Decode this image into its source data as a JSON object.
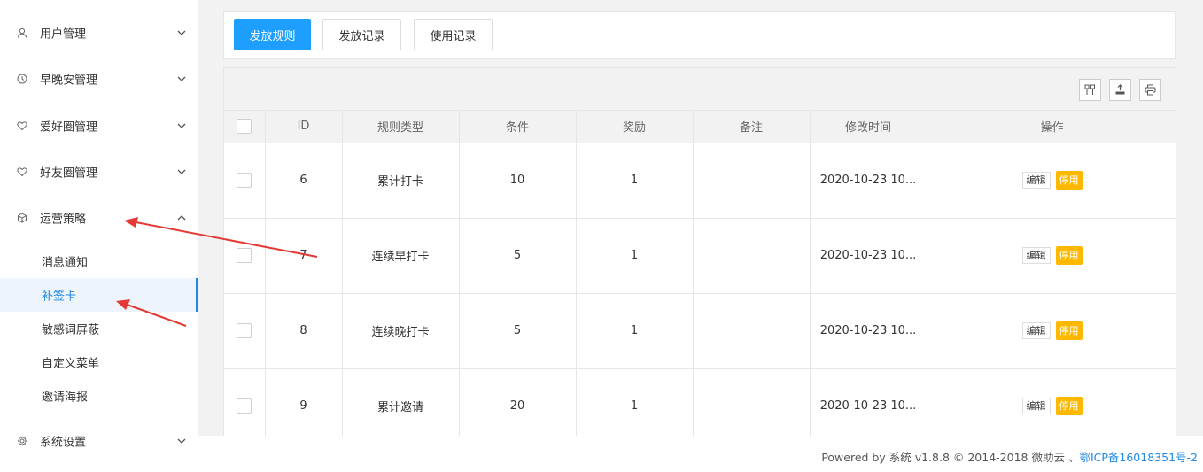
{
  "sidebar": {
    "menus": [
      {
        "label": "用户管理",
        "icon": "user-icon",
        "expanded": false
      },
      {
        "label": "早晚安管理",
        "icon": "clock-icon",
        "expanded": false
      },
      {
        "label": "爱好圈管理",
        "icon": "heart-icon",
        "expanded": false
      },
      {
        "label": "好友圈管理",
        "icon": "heart-icon",
        "expanded": false
      },
      {
        "label": "运营策略",
        "icon": "cube-icon",
        "expanded": true
      },
      {
        "label": "系统设置",
        "icon": "gear-icon",
        "expanded": false
      }
    ],
    "submenu": [
      {
        "label": "消息通知",
        "active": false
      },
      {
        "label": "补签卡",
        "active": true
      },
      {
        "label": "敏感词屏蔽",
        "active": false
      },
      {
        "label": "自定义菜单",
        "active": false
      },
      {
        "label": "邀请海报",
        "active": false
      }
    ]
  },
  "toolbar": {
    "tabs": [
      {
        "label": "发放规则",
        "primary": true
      },
      {
        "label": "发放记录",
        "primary": false
      },
      {
        "label": "使用记录",
        "primary": false
      }
    ]
  },
  "table": {
    "tools": [
      "columns-icon",
      "export-icon",
      "print-icon"
    ],
    "headers": [
      "ID",
      "规则类型",
      "条件",
      "奖励",
      "备注",
      "修改时间",
      "操作"
    ],
    "rows": [
      {
        "id": "6",
        "type": "累计打卡",
        "condition": "10",
        "reward": "1",
        "note": "",
        "time": "2020-10-23 10...",
        "edit": "编辑",
        "disable": "停用"
      },
      {
        "id": "7",
        "type": "连续早打卡",
        "condition": "5",
        "reward": "1",
        "note": "",
        "time": "2020-10-23 10...",
        "edit": "编辑",
        "disable": "停用"
      },
      {
        "id": "8",
        "type": "连续晚打卡",
        "condition": "5",
        "reward": "1",
        "note": "",
        "time": "2020-10-23 10...",
        "edit": "编辑",
        "disable": "停用"
      },
      {
        "id": "9",
        "type": "累计邀请",
        "condition": "20",
        "reward": "1",
        "note": "",
        "time": "2020-10-23 10...",
        "edit": "编辑",
        "disable": "停用"
      }
    ]
  },
  "footer": {
    "text": "Powered by 系统 v1.8.8 © 2014-2018 微助云 、",
    "icp": "鄂ICP备16018351号-2"
  },
  "colors": {
    "primary": "#1e9fff",
    "active": "#1e88e5",
    "warn": "#ffb800",
    "annotation": "#e53935"
  }
}
